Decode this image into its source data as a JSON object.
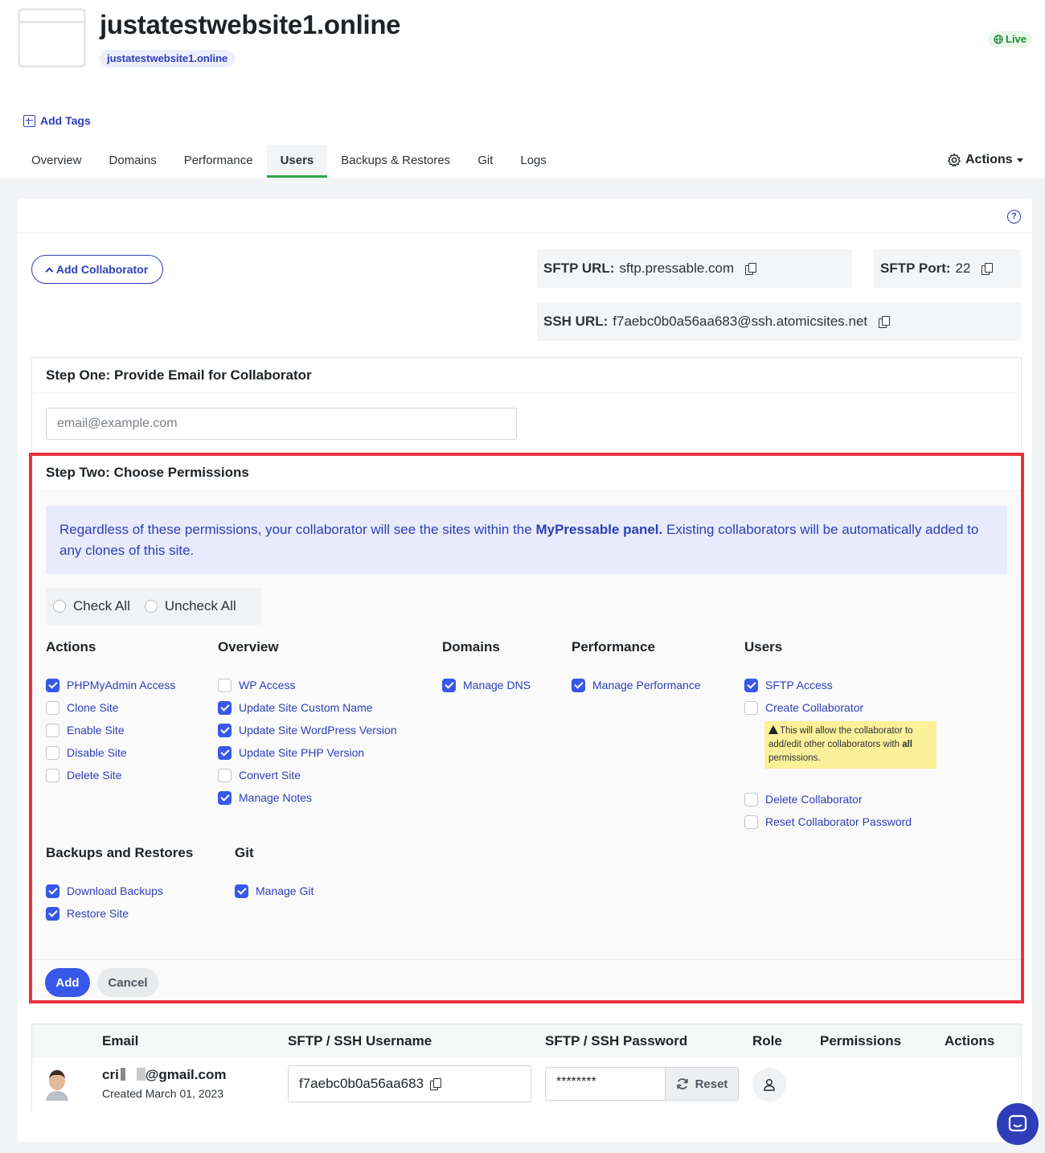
{
  "site": {
    "title": "justatestwebsite1.online",
    "domain_chip": "justatestwebsite1.online",
    "status": "Live"
  },
  "tags": {
    "add_label": "Add Tags"
  },
  "tabs": [
    {
      "label": "Overview"
    },
    {
      "label": "Domains"
    },
    {
      "label": "Performance"
    },
    {
      "label": "Users",
      "active": true
    },
    {
      "label": "Backups & Restores"
    },
    {
      "label": "Git"
    },
    {
      "label": "Logs"
    }
  ],
  "actions_menu": {
    "label": "Actions"
  },
  "help": {
    "glyph": "?"
  },
  "add_collaborator": {
    "label": "Add Collaborator"
  },
  "sftp": {
    "url_label": "SFTP URL:",
    "url_value": "sftp.pressable.com",
    "port_label": "SFTP Port:",
    "port_value": "22",
    "ssh_label": "SSH URL:",
    "ssh_value": "f7aebc0b0a56aa683@ssh.atomicsites.net"
  },
  "step_one": {
    "title": "Step One: Provide Email for Collaborator",
    "placeholder": "email@example.com"
  },
  "step_two": {
    "title": "Step Two: Choose Permissions",
    "notice_part1": "Regardless of these permissions, your collaborator will see the sites within the ",
    "notice_bold": "MyPressable panel.",
    "notice_part2": " Existing collaborators will be automatically added to any clones of this site.",
    "check_all": "Check All",
    "uncheck_all": "Uncheck All",
    "groups": {
      "actions": {
        "title": "Actions",
        "items": [
          {
            "label": "PHPMyAdmin Access",
            "checked": true
          },
          {
            "label": "Clone Site",
            "checked": false
          },
          {
            "label": "Enable Site",
            "checked": false
          },
          {
            "label": "Disable Site",
            "checked": false
          },
          {
            "label": "Delete Site",
            "checked": false
          }
        ]
      },
      "overview": {
        "title": "Overview",
        "items": [
          {
            "label": "WP Access",
            "checked": false
          },
          {
            "label": "Update Site Custom Name",
            "checked": true
          },
          {
            "label": "Update Site WordPress Version",
            "checked": true
          },
          {
            "label": "Update Site PHP Version",
            "checked": true
          },
          {
            "label": "Convert Site",
            "checked": false
          },
          {
            "label": "Manage Notes",
            "checked": true
          }
        ]
      },
      "domains": {
        "title": "Domains",
        "items": [
          {
            "label": "Manage DNS",
            "checked": true
          }
        ]
      },
      "performance": {
        "title": "Performance",
        "items": [
          {
            "label": "Manage Performance",
            "checked": true
          }
        ]
      },
      "users": {
        "title": "Users",
        "items": [
          {
            "label": "SFTP Access",
            "checked": true
          },
          {
            "label": "Create Collaborator",
            "checked": false
          },
          {
            "label": "Delete Collaborator",
            "checked": false
          },
          {
            "label": "Reset Collaborator Password",
            "checked": false
          }
        ],
        "warning_part1": "This will allow the collaborator to add/edit other collaborators with ",
        "warning_bold": "all",
        "warning_part2": " permissions."
      },
      "backups": {
        "title": "Backups and Restores",
        "items": [
          {
            "label": "Download Backups",
            "checked": true
          },
          {
            "label": "Restore Site",
            "checked": true
          }
        ]
      },
      "git": {
        "title": "Git",
        "items": [
          {
            "label": "Manage Git",
            "checked": true
          }
        ]
      }
    },
    "add_button": "Add",
    "cancel_button": "Cancel"
  },
  "collaborators_table": {
    "headers": {
      "email": "Email",
      "username": "SFTP / SSH Username",
      "password": "SFTP / SSH Password",
      "role": "Role",
      "permissions": "Permissions",
      "actions": "Actions"
    },
    "rows": [
      {
        "email_prefix": "cri",
        "email_suffix": "@gmail.com",
        "created": "Created March 01, 2023",
        "username": "f7aebc0b0a56aa683",
        "password_masked": "********",
        "reset_label": "Reset"
      }
    ]
  },
  "colors": {
    "accent": "#2e3eb8",
    "checkbox_blue": "#3858e9",
    "highlight_red": "#e8323e",
    "live_green": "#1f8a34",
    "warning_yellow": "#fcf09a"
  },
  "icons": [
    "site-thumbnail-icon",
    "globe-icon",
    "plus-square-icon",
    "gear-icon",
    "help-icon",
    "chevron-up-icon",
    "copy-icon",
    "warning-icon",
    "refresh-icon",
    "user-icon",
    "chat-icon"
  ]
}
